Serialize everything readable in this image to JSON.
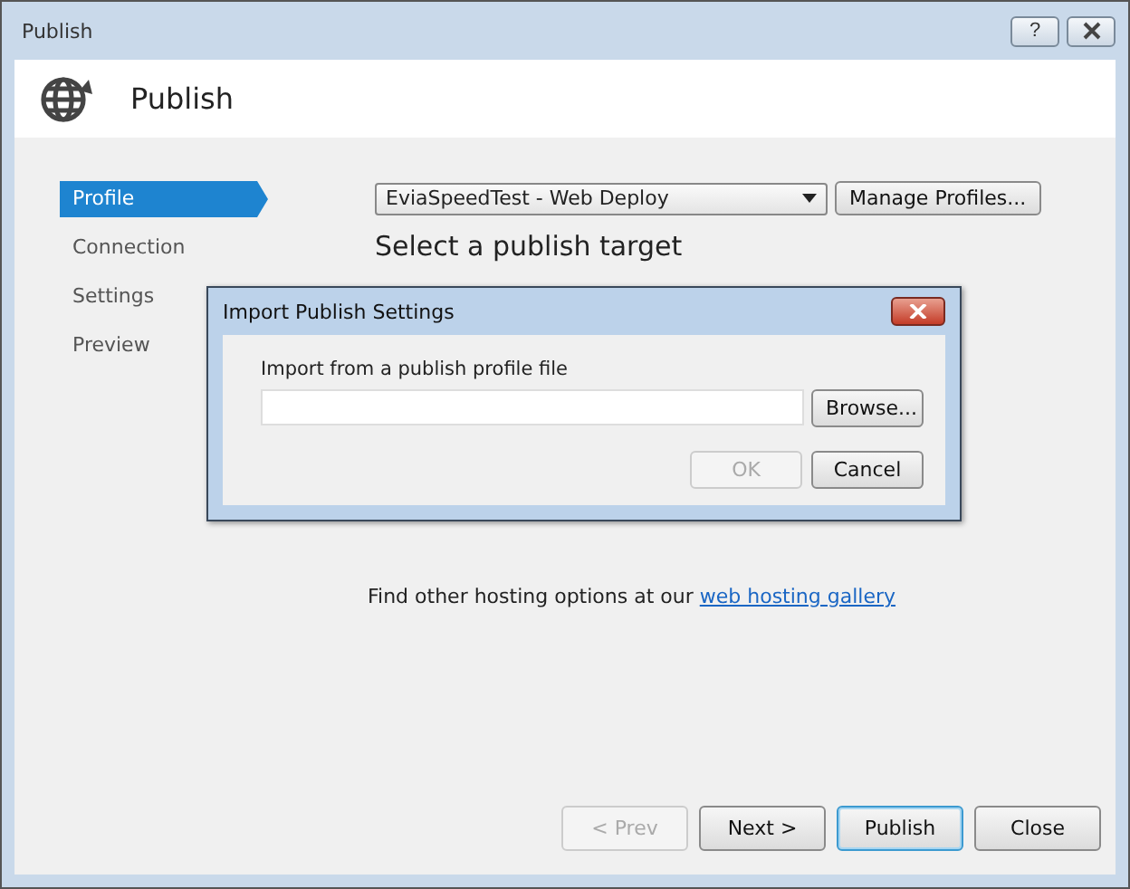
{
  "window": {
    "title": "Publish",
    "help": "?"
  },
  "header": {
    "title": "Publish"
  },
  "sidebar": {
    "items": [
      {
        "label": "Profile",
        "selected": true
      },
      {
        "label": "Connection",
        "selected": false
      },
      {
        "label": "Settings",
        "selected": false
      },
      {
        "label": "Preview",
        "selected": false
      }
    ]
  },
  "profile": {
    "value": "EviaSpeedTest - Web Deploy",
    "manage_button": "Manage Profiles..."
  },
  "section_title": "Select a publish target",
  "hosting": {
    "text": "Find other hosting options at our ",
    "link": "web hosting gallery"
  },
  "buttons": [
    {
      "label": "< Prev",
      "disabled": true,
      "default": false
    },
    {
      "label": "Next >",
      "disabled": false,
      "default": false
    },
    {
      "label": "Publish",
      "disabled": false,
      "default": true
    },
    {
      "label": "Close",
      "disabled": false,
      "default": false
    }
  ],
  "dialog": {
    "title": "Import Publish Settings",
    "field_label": "Import from a publish profile file",
    "browse": "Browse...",
    "buttons": [
      {
        "label": "OK",
        "disabled": true
      },
      {
        "label": "Cancel",
        "disabled": false
      }
    ]
  }
}
